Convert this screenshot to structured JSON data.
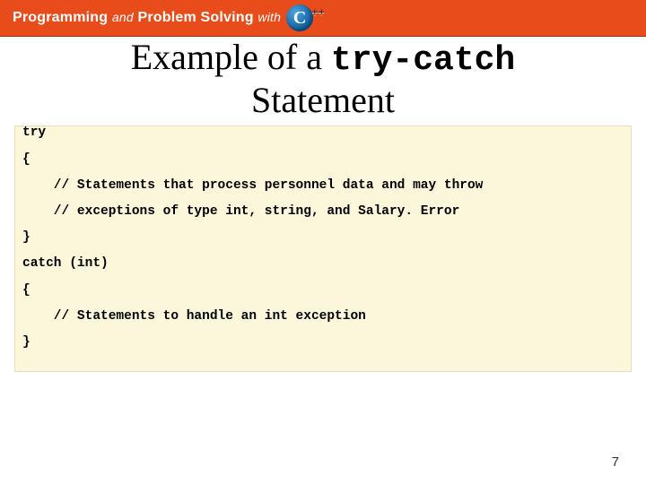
{
  "banner": {
    "word1": "Programming",
    "and": "and",
    "word2": "Problem Solving",
    "with": "with",
    "cpp_c": "C",
    "cpp_pp": "++"
  },
  "title": {
    "pre": "Example of a ",
    "mono": "try-catch",
    "post": " Statement"
  },
  "code": {
    "l0": "try",
    "l1": "{",
    "l2": "    // Statements that process personnel data and may throw",
    "l3": "    // exceptions of type int, string, and Salary. Error",
    "l4": "}",
    "l5": "catch (int)",
    "l6": "{",
    "l7": "    // Statements to handle an int exception",
    "l8": "}"
  },
  "page_number": "7"
}
